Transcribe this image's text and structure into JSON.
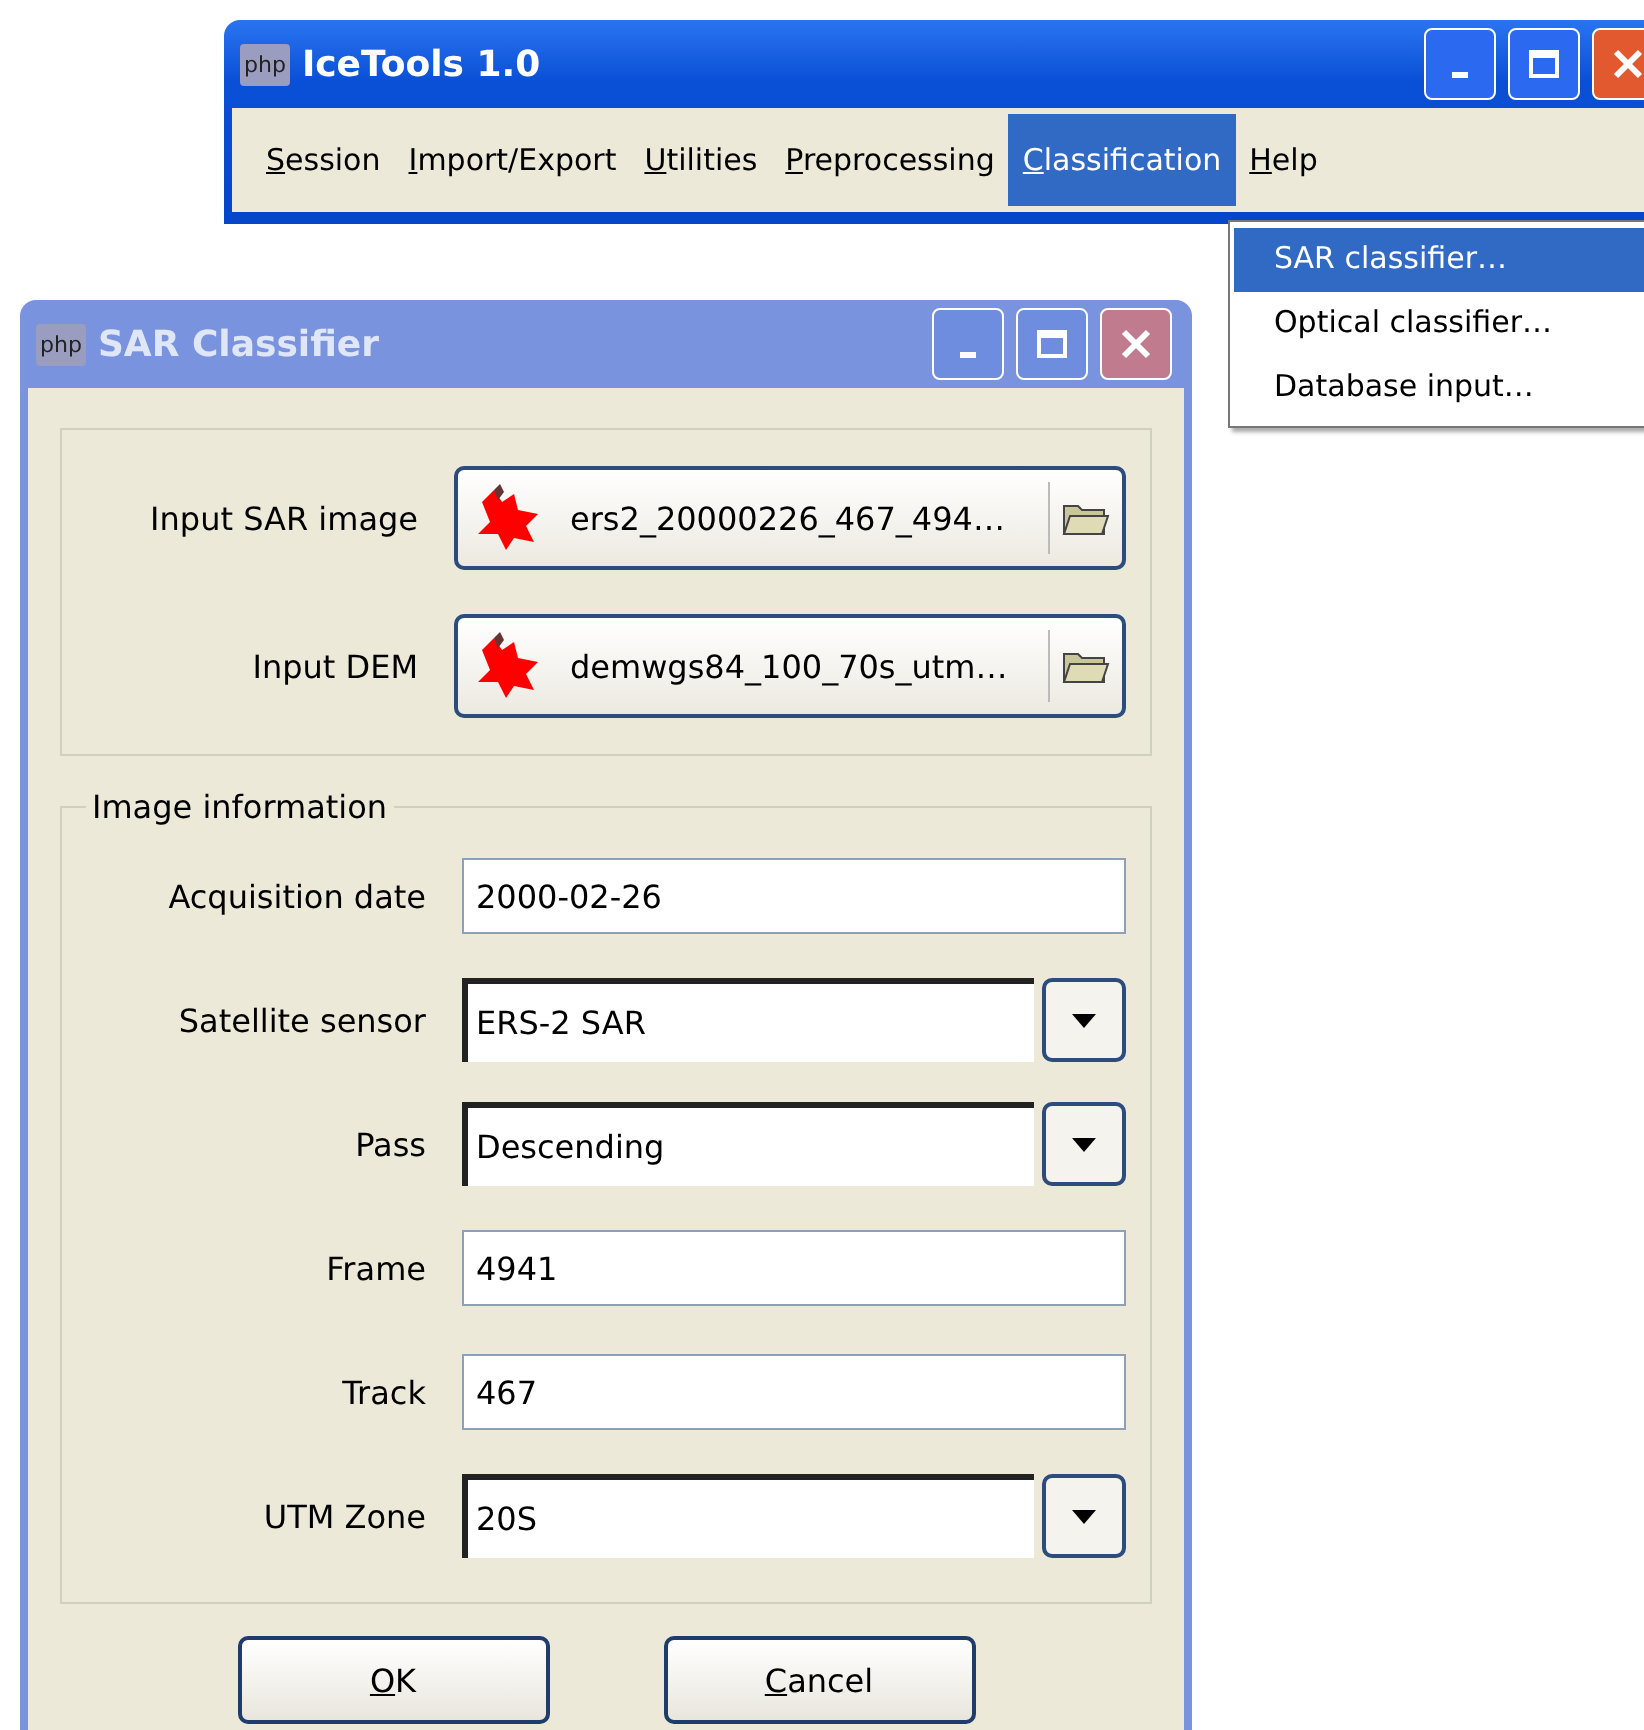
{
  "main_window": {
    "icon_text": "php",
    "title": "IceTools 1.0",
    "active": true,
    "menu": [
      {
        "label": "Session",
        "selected": false
      },
      {
        "label": "Import/Export",
        "selected": false
      },
      {
        "label": "Utilities",
        "selected": false
      },
      {
        "label": "Preprocessing",
        "selected": false
      },
      {
        "label": "Classification",
        "selected": true
      },
      {
        "label": "Help",
        "selected": false
      }
    ],
    "dropdown": [
      {
        "label": "SAR classifier…",
        "selected": true
      },
      {
        "label": "Optical classifier…",
        "selected": false
      },
      {
        "label": "Database input…",
        "selected": false
      }
    ]
  },
  "dialog": {
    "icon_text": "php",
    "title": "SAR Classifier",
    "active": false,
    "files": [
      {
        "label": "Input SAR image",
        "value": "ers2_20000226_467_494…"
      },
      {
        "label": "Input DEM",
        "value": "demwgs84_100_70s_utm…"
      }
    ],
    "group": {
      "title": "Image information",
      "fields": [
        {
          "label": "Acquisition date",
          "value": "2000-02-26",
          "kind": "text"
        },
        {
          "label": "Satellite sensor",
          "value": "ERS-2 SAR",
          "kind": "combo"
        },
        {
          "label": "Pass",
          "value": "Descending",
          "kind": "combo"
        },
        {
          "label": "Frame",
          "value": "4941",
          "kind": "text"
        },
        {
          "label": "Track",
          "value": "467",
          "kind": "text"
        },
        {
          "label": "UTM Zone",
          "value": "20S",
          "kind": "combo"
        }
      ]
    },
    "buttons": [
      "OK",
      "Cancel"
    ]
  }
}
